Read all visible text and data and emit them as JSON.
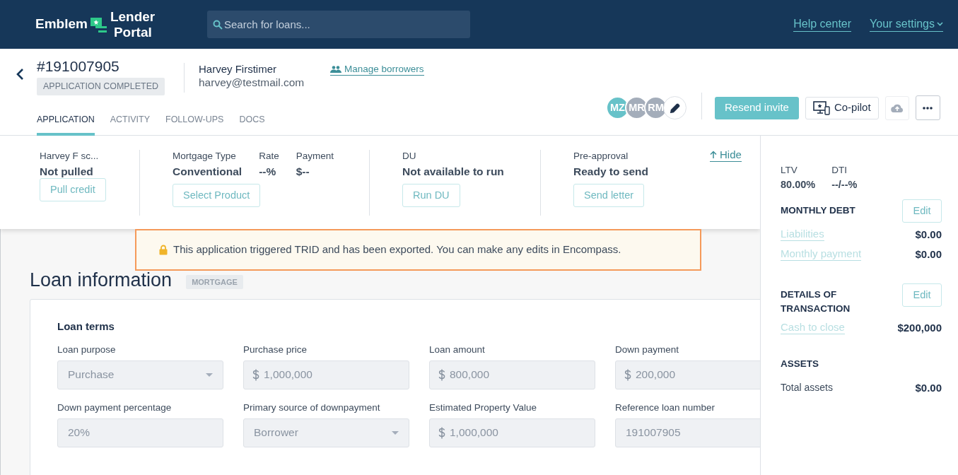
{
  "header": {
    "logo": {
      "brand": "Emblem",
      "product_line_1": "Lender",
      "product_line_2": "Portal"
    },
    "search": {
      "placeholder": "Search for loans..."
    },
    "links": [
      {
        "label": "Help center",
        "kind": "link"
      },
      {
        "label": "Your settings",
        "kind": "menu"
      }
    ]
  },
  "loan": {
    "number": "#191007905",
    "status": "APPLICATION COMPLETED",
    "borrower_name": "Harvey Firstimer",
    "borrower_email": "harvey@testmail.com",
    "manage_link": "Manage borrowers"
  },
  "tabs": [
    {
      "label": "APPLICATION",
      "selected": true
    },
    {
      "label": "ACTIVITY",
      "selected": false
    },
    {
      "label": "FOLLOW-UPS",
      "selected": false
    },
    {
      "label": "DOCS",
      "selected": false
    }
  ],
  "avatars": [
    {
      "initials": "MZ",
      "color": "#67c2c9"
    },
    {
      "initials": "MR",
      "color": "#a4adba"
    },
    {
      "initials": "RM",
      "color": "#a4adba"
    }
  ],
  "actions": [
    {
      "label": "Resend invite",
      "kind": "primary"
    },
    {
      "label": "Co-pilot",
      "kind": "copilot"
    },
    {
      "kind": "upload",
      "disabled": true
    },
    {
      "kind": "more",
      "disabled": false
    }
  ],
  "summary": {
    "sections": [
      {
        "items": [
          {
            "label": "Harvey F sc...",
            "value": "Not pulled"
          }
        ],
        "button": {
          "label": "Pull credit",
          "disabled": true
        }
      },
      {
        "items": [
          {
            "label": "Mortgage Type",
            "value": "Conventional"
          },
          {
            "label": "Rate",
            "value": "--%"
          },
          {
            "label": "Payment",
            "value": "$--"
          }
        ],
        "button": {
          "label": "Select Product",
          "disabled": true
        }
      },
      {
        "items": [
          {
            "label": "DU",
            "value": "Not available to run"
          }
        ],
        "button": {
          "label": "Run DU",
          "disabled": true
        }
      },
      {
        "items": [
          {
            "label": "Pre-approval",
            "value": "Ready to send"
          }
        ],
        "button": {
          "label": "Send letter",
          "disabled": true
        }
      }
    ],
    "hide_link": "Hide"
  },
  "banner": {
    "text": "This application triggered TRID and has been exported. You can make any edits in Encompass."
  },
  "main": {
    "title": "Loan information",
    "badge": "MORTGAGE",
    "card": {
      "title": "Loan terms",
      "fields": [
        {
          "label": "Loan purpose",
          "value": "Purchase",
          "kind": "select",
          "disabled": true
        },
        {
          "label": "Purchase price",
          "value": "1,000,000",
          "kind": "currency",
          "disabled": true
        },
        {
          "label": "Loan amount",
          "value": "800,000",
          "kind": "currency",
          "disabled": true
        },
        {
          "label": "Down payment",
          "value": "200,000",
          "kind": "currency",
          "disabled": true
        },
        {
          "label": "Down payment percentage",
          "value": "20%",
          "kind": "text",
          "disabled": true
        },
        {
          "label": "Primary source of downpayment",
          "value": "Borrower",
          "kind": "select",
          "disabled": true
        },
        {
          "label": "Estimated Property Value",
          "value": "1,000,000",
          "kind": "currency",
          "disabled": true
        },
        {
          "label": "Reference loan number",
          "value": "191007905",
          "kind": "text",
          "disabled": true
        }
      ]
    }
  },
  "sidebar": {
    "ratios": [
      {
        "label": "LTV",
        "value": "80.00%"
      },
      {
        "label": "DTI",
        "value": "--/--%"
      }
    ],
    "sections": [
      {
        "title": "MONTHLY DEBT",
        "edit_button": {
          "label": "Edit",
          "disabled": true
        },
        "rows": [
          {
            "label": "Liabilities",
            "value": "$0.00",
            "kind": "link"
          },
          {
            "label": "Monthly payment",
            "value": "$0.00",
            "kind": "link"
          }
        ]
      },
      {
        "title": "DETAILS OF TRANSACTION",
        "edit_button": {
          "label": "Edit",
          "disabled": true
        },
        "rows": [
          {
            "label": "Cash to close",
            "value": "$200,000",
            "kind": "link"
          }
        ]
      },
      {
        "title": "ASSETS",
        "rows": [
          {
            "label": "Total assets",
            "value": "$0.00",
            "kind": "plain"
          }
        ]
      }
    ]
  }
}
